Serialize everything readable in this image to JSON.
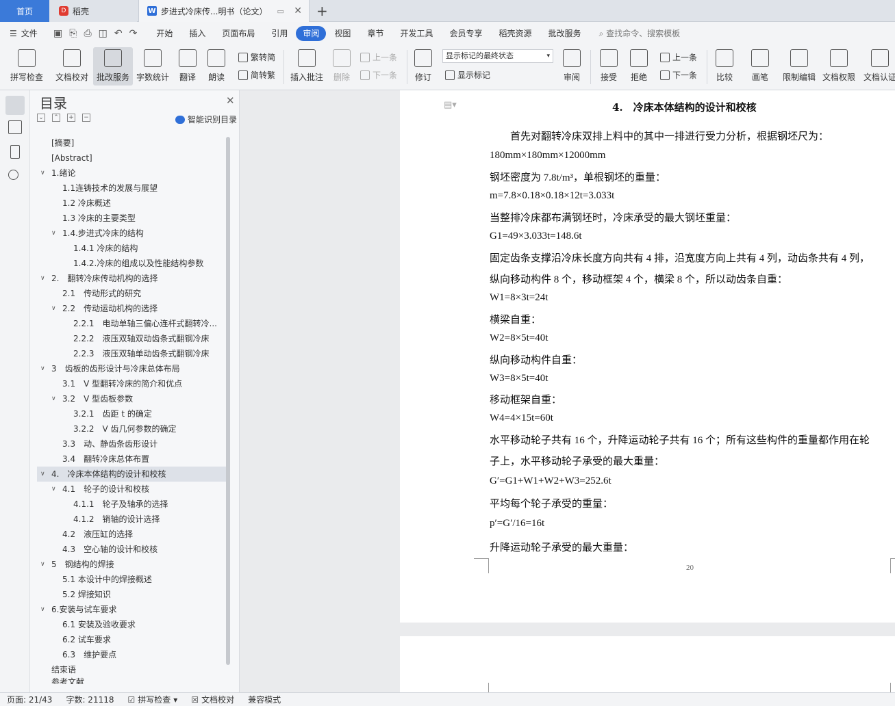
{
  "tabs": {
    "home": "首页",
    "daoke": "稻壳",
    "doc": "步进式冷床传...明书（论文）"
  },
  "menu": {
    "file": "文件",
    "items": [
      "开始",
      "插入",
      "页面布局",
      "引用",
      "审阅",
      "视图",
      "章节",
      "开发工具",
      "会员专享",
      "稻壳资源",
      "批改服务"
    ],
    "active": "审阅",
    "search": "查找命令、搜索模板"
  },
  "ribbon": {
    "spell": "拼写检查",
    "doccheck": "文档校对",
    "correct": "批改服务",
    "wordcount": "字数统计",
    "translate": "翻译",
    "read": "朗读",
    "trad": "繁转简",
    "simp": "简转繁",
    "insert_comment": "插入批注",
    "delete": "删除",
    "prev": "上一条",
    "next": "下一条",
    "revise": "修订",
    "markup_state": "显示标记的最终状态",
    "show_markup": "显示标记",
    "review": "审阅",
    "accept": "接受",
    "reject": "拒绝",
    "prev2": "上一条",
    "next2": "下一条",
    "compare": "比较",
    "pen": "画笔",
    "restrict": "限制编辑",
    "rights": "文档权限",
    "auth": "文档认证"
  },
  "toc": {
    "title": "目录",
    "smart": "智能识别目录",
    "items": [
      {
        "label": "[摘要]"
      },
      {
        "label": "[Abstract]"
      },
      {
        "label": "1.绪论"
      },
      {
        "label": "1.1连铸技术的发展与展望"
      },
      {
        "label": "1.2 冷床概述"
      },
      {
        "label": "1.3 冷床的主要类型"
      },
      {
        "label": "1.4.步进式冷床的结构"
      },
      {
        "label": "1.4.1 冷床的结构"
      },
      {
        "label": "1.4.2.冷床的组成以及性能结构参数"
      },
      {
        "label": "2.　翻转冷床传动机构的选择"
      },
      {
        "label": "2.1　传动形式的研究"
      },
      {
        "label": "2.2　传动运动机构的选择"
      },
      {
        "label": "2.2.1　电动单轴三偏心连杆式翻转冷..."
      },
      {
        "label": "2.2.2　液压双轴双动齿条式翻钢冷床"
      },
      {
        "label": "2.2.3　液压双轴单动齿条式翻钢冷床"
      },
      {
        "label": "3　齿板的齿形设计与冷床总体布局"
      },
      {
        "label": "3.1　V 型翻转冷床的简介和优点"
      },
      {
        "label": "3.2　V 型齿板参数"
      },
      {
        "label": "3.2.1　齿距 t 的确定"
      },
      {
        "label": "3.2.2　V 齿几何参数的确定"
      },
      {
        "label": "3.3　动、静齿条齿形设计"
      },
      {
        "label": "3.4　翻转冷床总体布置"
      },
      {
        "label": "4.　冷床本体结构的设计和校核"
      },
      {
        "label": "4.1　轮子的设计和校核"
      },
      {
        "label": "4.1.1　轮子及轴承的选择"
      },
      {
        "label": "4.1.2　销轴的设计选择"
      },
      {
        "label": "4.2　液压缸的选择"
      },
      {
        "label": "4.3　空心轴的设计和校核"
      },
      {
        "label": "5　钢结构的焊接"
      },
      {
        "label": "5.1 本设计中的焊接概述"
      },
      {
        "label": "5.2 焊接知识"
      },
      {
        "label": "6.安装与试车要求"
      },
      {
        "label": "6.1 安装及验收要求"
      },
      {
        "label": "6.2 试车要求"
      },
      {
        "label": "6.3　维护要点"
      },
      {
        "label": "结束语"
      },
      {
        "label": "参考文献"
      }
    ]
  },
  "doc": {
    "heading": "4.　冷床本体结构的设计和校核",
    "lines": [
      "　　首先对翻转冷床双排上料中的其中一排进行受力分析，根据钢坯尺为：",
      "180mm×180mm×12000mm",
      "钢坯密度为 7.8t/m³，单根钢坯的重量：",
      "m=7.8×0.18×0.18×12t=3.033t",
      "当整排冷床都布满钢坯时，冷床承受的最大钢坯重量：",
      "G1=49×3.033t=148.6t",
      "固定齿条支撑沿冷床长度方向共有 4 排，沿宽度方向上共有 4 列，动齿条共有 4 列，",
      "纵向移动构件 8 个，移动框架 4 个，横梁 8 个，所以动齿条自重：",
      "W1=8×3t=24t",
      "横梁自重：",
      "W2=8×5t=40t",
      "纵向移动构件自重：",
      "W3=8×5t=40t",
      "移动框架自重：",
      "W4=4×15t=60t",
      "水平移动轮子共有 16 个，升降运动轮子共有 16 个；所有这些构件的重量都作用在轮",
      "子上，水平移动轮子承受的最大重量：",
      "G′=G1+W1+W2+W3=252.6t",
      "平均每个轮子承受的重量：",
      "p′=G′/16=16t",
      "升降运动轮子承受的最大重量："
    ],
    "page_number": "20"
  },
  "status": {
    "page": "页面: 21/43",
    "words": "字数: 21118",
    "spell": "拼写检查",
    "doccheck": "文档校对",
    "compat": "兼容模式"
  }
}
